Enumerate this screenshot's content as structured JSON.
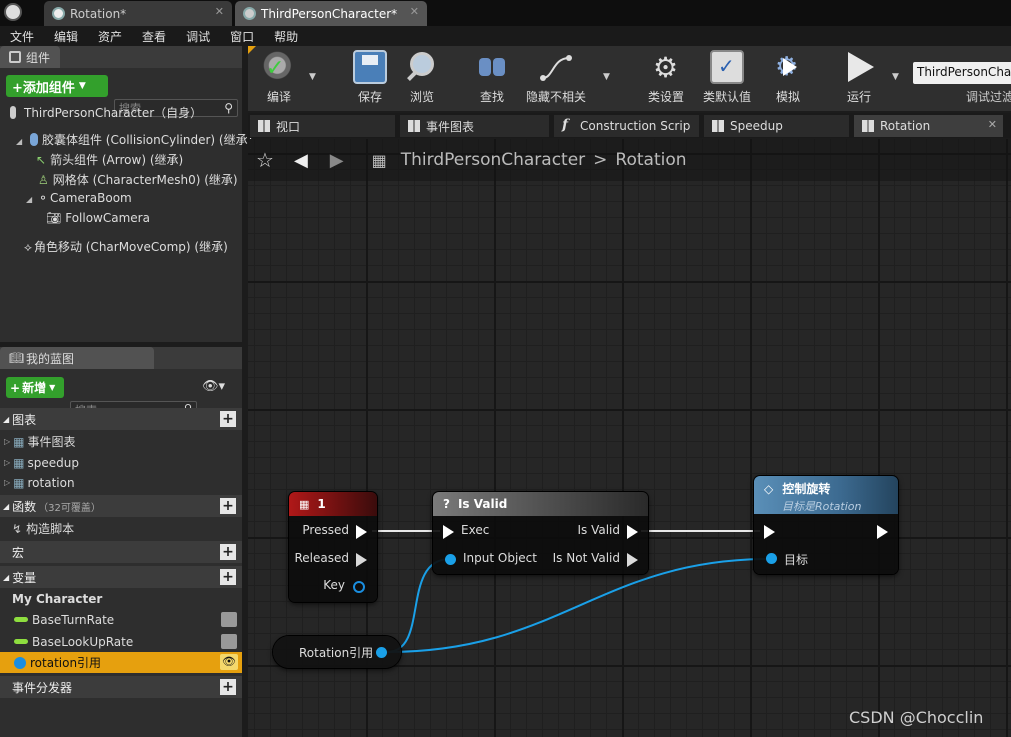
{
  "tabs": [
    {
      "label": "Rotation*"
    },
    {
      "label": "ThirdPersonCharacter*"
    }
  ],
  "menu": [
    "文件",
    "编辑",
    "资产",
    "查看",
    "调试",
    "窗口",
    "帮助"
  ],
  "components_panel": {
    "tab": "组件",
    "add_button": "+添加组件",
    "search_placeholder": "搜索",
    "root": "ThirdPersonCharacter（自身）",
    "items": [
      "胶囊体组件 (CollisionCylinder) (继承)",
      "箭头组件 (Arrow) (继承)",
      "网格体 (CharacterMesh0) (继承)",
      "CameraBoom",
      "FollowCamera",
      "角色移动 (CharMoveComp) (继承)"
    ]
  },
  "my_blueprint": {
    "tab": "我的蓝图",
    "new_button": "新增",
    "search_placeholder": "搜索",
    "graphs_header": "图表",
    "graphs": [
      "事件图表",
      "speedup",
      "rotation"
    ],
    "functions_header": "函数",
    "functions_note": "（32可覆盖）",
    "functions": [
      "构造脚本"
    ],
    "macros_header": "宏",
    "variables_header": "变量",
    "variable_category": "My Character",
    "variables": [
      "BaseTurnRate",
      "BaseLookUpRate",
      "rotation引用"
    ],
    "dispatchers_header": "事件分发器"
  },
  "toolbar": {
    "compile": "编译",
    "save": "保存",
    "browse": "浏览",
    "find": "查找",
    "hide_unrelated": "隐藏不相关",
    "class_settings": "类设置",
    "class_defaults": "类默认值",
    "simulate": "模拟",
    "play": "运行",
    "debug_target": "ThirdPersonChar",
    "debug_filter": "调试过滤"
  },
  "doc_tabs": [
    "视口",
    "事件图表",
    "Construction Scrip",
    "Speedup",
    "Rotation"
  ],
  "breadcrumb": {
    "root": "ThirdPersonCharacter",
    "sep": ">",
    "current": "Rotation"
  },
  "nodes": {
    "key_node": {
      "title": "1",
      "pins": [
        "Pressed",
        "Released",
        "Key"
      ]
    },
    "is_valid": {
      "title": "Is Valid",
      "q": "?",
      "in_exec": "Exec",
      "in_obj": "Input Object",
      "out_valid": "Is Valid",
      "out_not_valid": "Is Not Valid"
    },
    "control_rotation": {
      "title": "控制旋转",
      "subtitle": "目标是Rotation",
      "target": "目标"
    },
    "var_node": {
      "label": "Rotation引用"
    }
  },
  "watermark": "CSDN @Chocclin",
  "colors": {
    "accent_green": "#33a02c",
    "selection": "#e6a00e",
    "object_pin": "#1aa0e8"
  }
}
